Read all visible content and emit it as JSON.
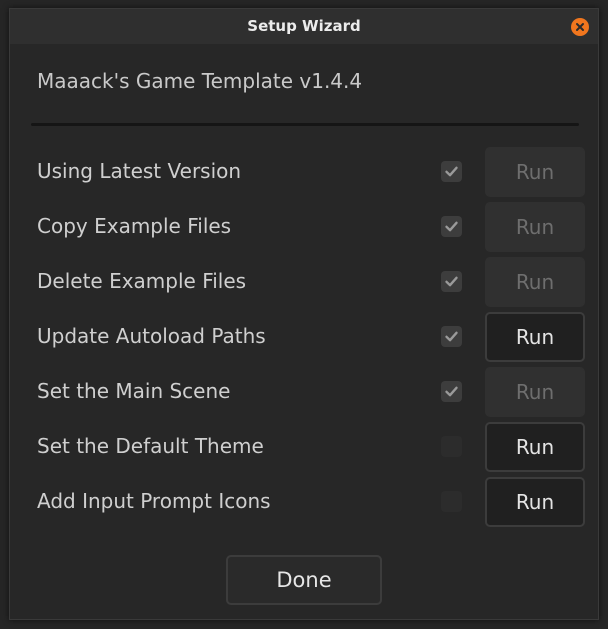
{
  "window": {
    "title": "Setup Wizard"
  },
  "header": {
    "app_name": "Maaack's Game Template v1.4.4"
  },
  "steps": [
    {
      "label": "Using Latest Version",
      "checked": true,
      "run_label": "Run",
      "run_enabled": false
    },
    {
      "label": "Copy Example Files",
      "checked": true,
      "run_label": "Run",
      "run_enabled": false
    },
    {
      "label": "Delete Example Files",
      "checked": true,
      "run_label": "Run",
      "run_enabled": false
    },
    {
      "label": "Update Autoload Paths",
      "checked": true,
      "run_label": "Run",
      "run_enabled": true
    },
    {
      "label": "Set the Main Scene",
      "checked": true,
      "run_label": "Run",
      "run_enabled": false
    },
    {
      "label": "Set the Default Theme",
      "checked": false,
      "run_label": "Run",
      "run_enabled": true
    },
    {
      "label": "Add Input Prompt Icons",
      "checked": false,
      "run_label": "Run",
      "run_enabled": true
    }
  ],
  "footer": {
    "done_label": "Done"
  },
  "colors": {
    "close_accent": "#f0761e",
    "background": "#272727",
    "titlebar": "#2f2f2f"
  }
}
